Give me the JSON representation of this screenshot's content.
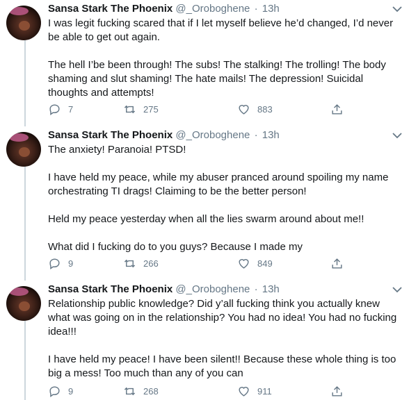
{
  "tweets": [
    {
      "name": "Sansa Stark The Phoenix",
      "handle": "@_Oroboghene",
      "dot": "·",
      "time": "13h",
      "paragraphs": [
        "I was legit fucking scared that if I let myself believe he’d changed, I’d never be able to get out again.",
        "The hell I’be been through! The subs! The stalking! The trolling! The body shaming and slut shaming! The hate mails! The depression! Suicidal thoughts and attempts!"
      ],
      "replies": "7",
      "retweets": "275",
      "likes": "883"
    },
    {
      "name": "Sansa Stark The Phoenix",
      "handle": "@_Oroboghene",
      "dot": "·",
      "time": "13h",
      "paragraphs": [
        "The anxiety! Paranoia! PTSD!",
        "I have held my peace, while my abuser pranced around spoiling my name orchestrating TI drags! Claiming to be the better person!",
        "Held my peace yesterday when all the lies swarm around about me!!",
        "What did I fucking do to you guys? Because I made my"
      ],
      "replies": "9",
      "retweets": "266",
      "likes": "849"
    },
    {
      "name": "Sansa Stark The Phoenix",
      "handle": "@_Oroboghene",
      "dot": "·",
      "time": "13h",
      "paragraphs": [
        "Relationship public knowledge? Did y’all fucking think you actually knew what was going on in the relationship? You had no idea! You had no fucking idea!!!",
        "I have held my peace! I have been silent!! Because these whole thing is too big a mess! Too much than any of you can"
      ],
      "replies": "9",
      "retweets": "268",
      "likes": "911"
    }
  ],
  "icons": {
    "reply": "reply-icon",
    "retweet": "retweet-icon",
    "like": "heart-icon",
    "share": "share-icon",
    "menu": "chevron-down-icon"
  },
  "colors": {
    "text": "#14171a",
    "secondary": "#657786",
    "thread_line": "#ccd6dd"
  }
}
